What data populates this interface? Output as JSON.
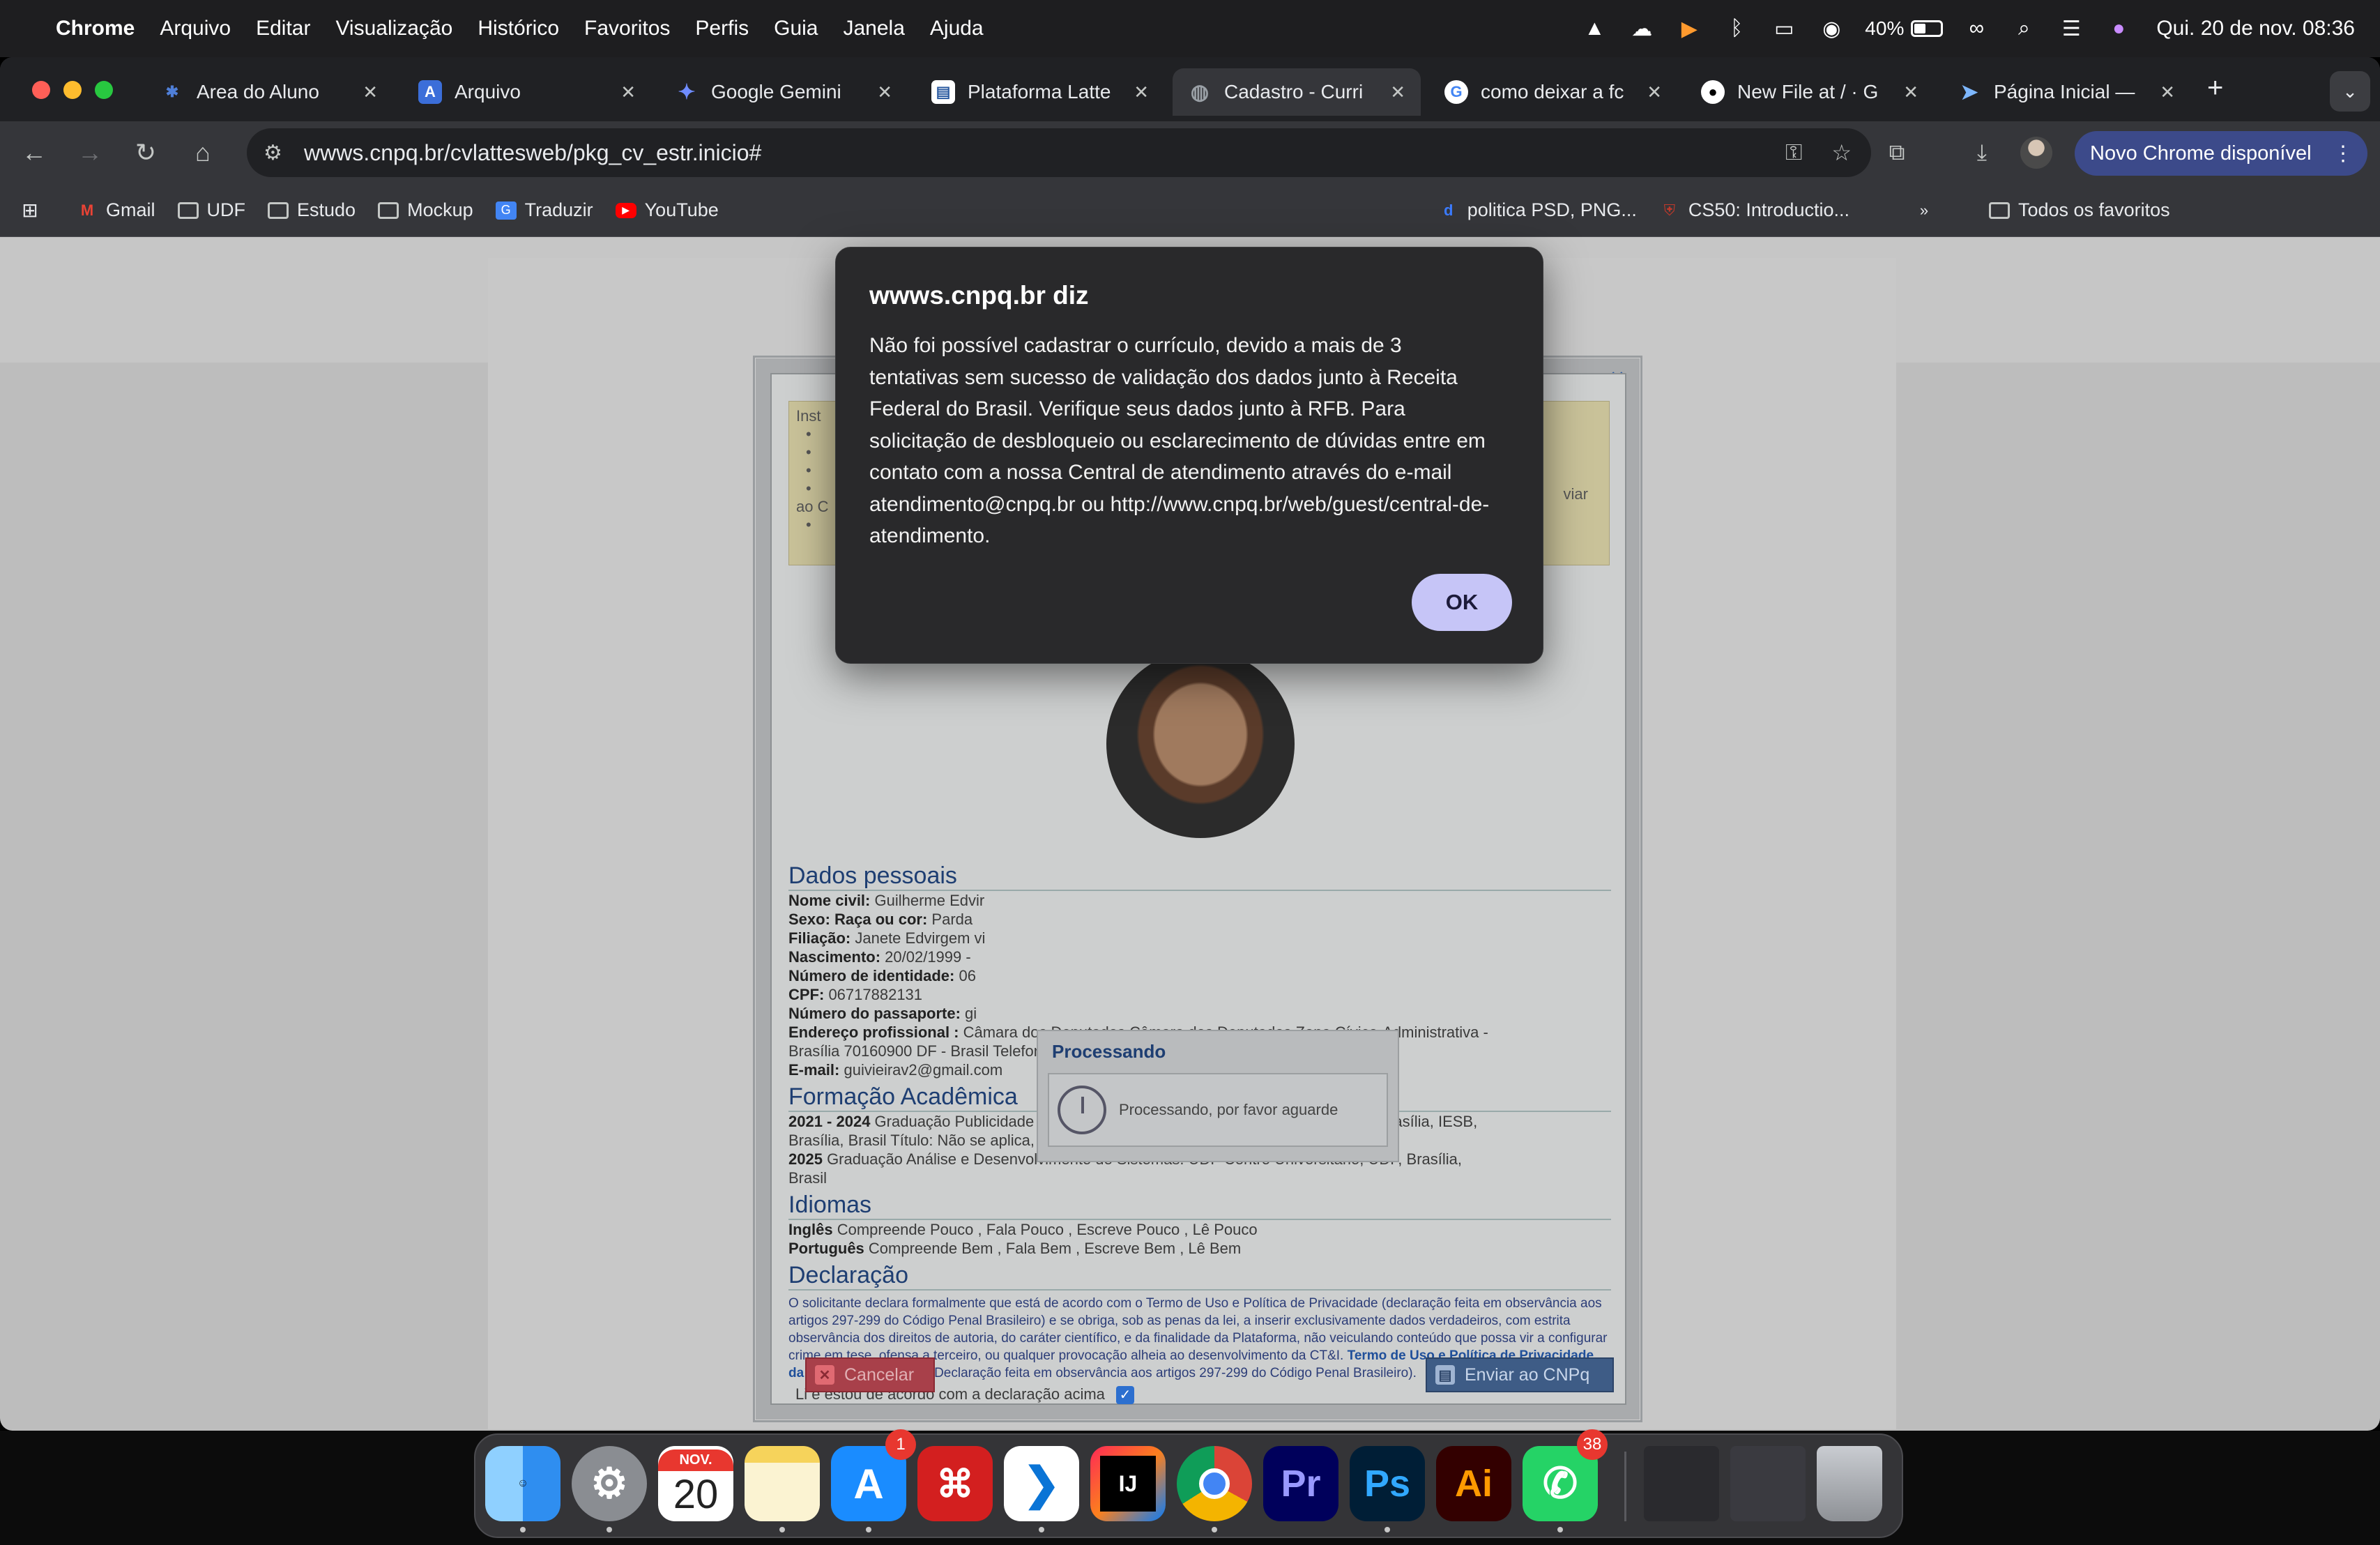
{
  "menubar": {
    "app": "Chrome",
    "items": [
      "Arquivo",
      "Editar",
      "Visualização",
      "Histórico",
      "Favoritos",
      "Perfis",
      "Guia",
      "Janela",
      "Ajuda"
    ],
    "battery": "40%",
    "datetime": "Qui. 20 de nov. 08:36"
  },
  "tabs": [
    {
      "title": "Area do Aluno",
      "icon_color": "#4f7fd8"
    },
    {
      "title": "Arquivo",
      "icon_color": "#3b6ed9"
    },
    {
      "title": "Google Gemini",
      "icon_color": "#6f8cff"
    },
    {
      "title": "Plataforma Latte",
      "icon_color": "#ffffff"
    },
    {
      "title": "Cadastro - Curri",
      "icon_color": "#9aa0a6"
    },
    {
      "title": "como deixar a fc",
      "icon_color": "#ffffff"
    },
    {
      "title": "New File at / · G",
      "icon_color": "#ffffff"
    },
    {
      "title": "Página Inicial —",
      "icon_color": "#7db7ff"
    }
  ],
  "toolbar": {
    "url": "wwws.cnpq.br/cvlattesweb/pkg_cv_estr.inicio#",
    "update_label": "Novo Chrome disponível"
  },
  "bookmarks": {
    "items": [
      "Gmail",
      "UDF",
      "Estudo",
      "Mockup",
      "Traduzir",
      "YouTube"
    ],
    "right_items": [
      "politica PSD, PNG...",
      "CS50: Introductio..."
    ],
    "all": "Todos os favoritos"
  },
  "dialog": {
    "title": "wwws.cnpq.br diz",
    "message": "Não foi possível cadastrar o currículo, devido a mais de 3 tentativas sem sucesso de validação dos dados junto à Receita Federal do Brasil. Verifique seus dados junto à RFB. Para solicitação de desbloqueio ou esclarecimento de dúvidas entre em contato com a nossa Central de atendimento através do e-mail atendimento@cnpq.br ou http://www.cnpq.br/web/guest/central-de-atendimento.",
    "ok": "OK"
  },
  "form": {
    "instr_title": "Inst",
    "instr_right": "viar",
    "instr_ao": "ao C",
    "dados_title": "Dados pessoais",
    "dados": [
      {
        "label": "Nome civil:",
        "value": " Guilherme Edvir"
      },
      {
        "label": "Sexo:",
        "value": "",
        "label2": " Raça ou cor:",
        "value2": " Parda"
      },
      {
        "label": "Filiação:",
        "value": " Janete Edvirgem vi"
      },
      {
        "label": "Nascimento:",
        "value": " 20/02/1999 -"
      },
      {
        "label": "Número de identidade:",
        "value": " 06"
      },
      {
        "label": "CPF:",
        "value": " 06717882131"
      },
      {
        "label": "Número do passaporte:",
        "value": " gi"
      },
      {
        "label": "Endereço profissional :",
        "value": " Câmara dos Deputados Câmara dos Deputados Zona Cívico-Administrativa -"
      },
      {
        "label": "",
        "value": "Brasília 70160900 DF - Brasil Telefone: 61 993837916"
      },
      {
        "label": "E-mail:",
        "value": " guivieirav2@gmail.com"
      }
    ],
    "formacao_title": "Formação Acadêmica",
    "formacao": [
      {
        "label": "2021 - 2024",
        "value": " Graduação Publicidade e Propaganda. Instituto de Educação Superior de Brasília, IESB,"
      },
      {
        "label": "",
        "value": "Brasília, Brasil Título: Não se aplica, Ano de obtenção: 2024 Orientador: Não se aplica"
      },
      {
        "label": "",
        "value": " "
      },
      {
        "label": "2025",
        "value": " Graduação Análise e Desenvolvimento de Sistemas. UDF Centro Universitário, UDF, Brasília,"
      },
      {
        "label": "",
        "value": "Brasil"
      }
    ],
    "idiomas_title": "Idiomas",
    "idiomas": [
      {
        "label": "Inglês",
        "value": " Compreende Pouco , Fala Pouco , Escreve Pouco , Lê Pouco"
      },
      {
        "label": "Português",
        "value": " Compreende Bem , Fala Bem , Escreve Bem , Lê Bem"
      }
    ],
    "declaracao_title": "Declaração",
    "declaracao": "O solicitante declara formalmente que está de acordo com o Termo de Uso e Política de Privacidade (declaração feita em observância aos artigos 297-299 do Código Penal Brasileiro) e se obriga, sob as penas da lei, a inserir exclusivamente dados verdadeiros, com estrita observância dos direitos de autoria, do caráter científico, e da finalidade da Plataforma, não veiculando conteúdo que possa vir a configurar crime em tese, ofensa a terceiro, ou qualquer provocação alheia ao desenvolvimento da CT&I.",
    "declaracao_link": " Termo de Uso e Política de Privacidade da Plataforma Lattes",
    "declaracao_tail": ". ( Declaração feita em observância aos artigos 297-299 do Código Penal Brasileiro).",
    "agree": "Li e estou de acordo com a declaração acima",
    "cancel": "Cancelar",
    "send": "Enviar ao CNPq"
  },
  "processing": {
    "title": "Processando",
    "message": "Processando, por favor aguarde"
  },
  "dock": {
    "calendar_month": "NOV.",
    "calendar_day": "20",
    "appstore_badge": "1",
    "whatsapp_badge": "38",
    "apps": [
      "Finder",
      "System Settings",
      "Calendar",
      "Notes",
      "App Store",
      "Acrobat",
      "VS Code",
      "IntelliJ",
      "Chrome",
      "Premiere",
      "Photoshop",
      "Illustrator",
      "WhatsApp"
    ],
    "pr_label": "Pr",
    "ps_label": "Ps",
    "ai_label": "Ai"
  }
}
